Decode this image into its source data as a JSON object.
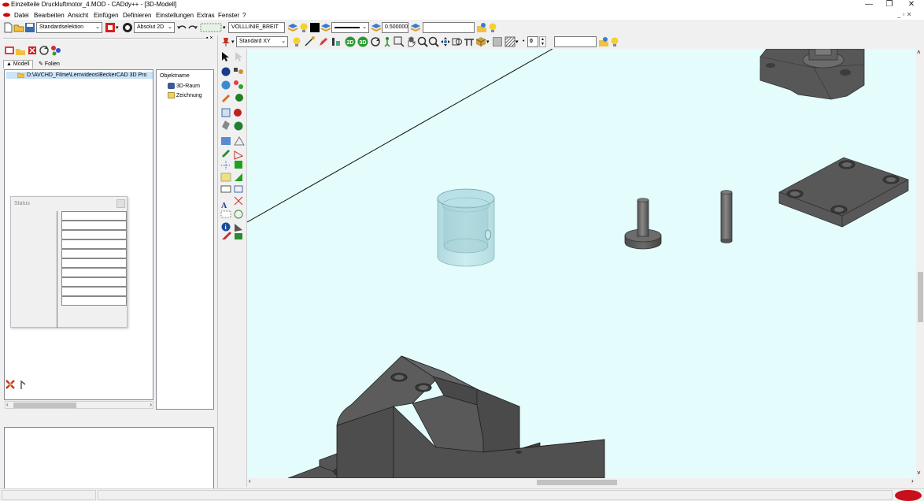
{
  "window": {
    "title": "Einzelteile Druckluftmotor_4.MOD  -  CADdy++ - [3D-Modell]",
    "controls": {
      "minimize": "—",
      "restore": "❐",
      "close": "✕"
    }
  },
  "menu": {
    "items": [
      "Datei",
      "Bearbeiten",
      "Ansicht",
      "Einfügen",
      "Definieren",
      "Einstellungen",
      "Extras",
      "Fenster",
      "?"
    ],
    "mdi_controls": "_  ▫  ✕"
  },
  "toolbar": {
    "selection_mode": "Standardselektion",
    "coord_mode": "Absolut 2D",
    "line_type": "VOLLLINIE_BREIT",
    "line_width": "0.500000",
    "view": "Standard XY",
    "stepper_value": "0"
  },
  "left_panel": {
    "tabs": [
      "Modell",
      "Folien"
    ],
    "tree_item": "D:\\AVCHD_Filme\\Lernvideos\\BeckerCAD 3D Pro",
    "object_header": "Objektname",
    "objects": [
      "3D-Raum",
      "Zeichnung"
    ],
    "status_title": "Status"
  },
  "colors": {
    "viewport_bg": "#e4fcfc",
    "part_dark": "#555555",
    "part_transparent": "#a8d4dc"
  },
  "icons": [
    "close-icon",
    "minimize-icon",
    "restore-icon",
    "new-file-icon",
    "open-folder-icon",
    "save-icon",
    "undo-icon",
    "redo-icon",
    "layer-icon",
    "lightbulb-icon",
    "zoom-icon",
    "pan-hand-icon",
    "rotate-icon",
    "info-icon",
    "measure-icon"
  ]
}
